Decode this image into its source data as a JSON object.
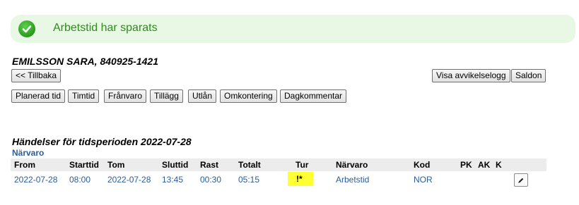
{
  "banner": {
    "message": "Arbetstid har sparats",
    "icon": "check-icon",
    "color": "#2e8b1c"
  },
  "person": {
    "title": "EMILSSON SARA, 840925-1421"
  },
  "nav": {
    "back_label": "<< Tillbaka",
    "deviation_log_label": "Visa avvikelselogg",
    "balances_label": "Saldon"
  },
  "tabs": [
    {
      "label": "Planerad tid"
    },
    {
      "label": "Timtid"
    },
    {
      "label": "Frånvaro"
    },
    {
      "label": "Tillägg"
    },
    {
      "label": "Utlån"
    },
    {
      "label": "Omkontering"
    },
    {
      "label": "Dagkommentar"
    }
  ],
  "events": {
    "title": "Händelser för tidsperioden 2022-07-28",
    "subtitle": "Närvaro",
    "columns": [
      "From",
      "Starttid",
      "Tom",
      "Sluttid",
      "Rast",
      "Totalt",
      "Tur",
      "Närvaro",
      "Kod",
      "PK",
      "AK",
      "K"
    ],
    "rows": [
      {
        "from": "2022-07-28",
        "starttid": "08:00",
        "tom": "2022-07-28",
        "sluttid": "13:45",
        "rast": "00:30",
        "totalt": "05:15",
        "tur": "!*",
        "narvaro": "Arbetstid",
        "kod": "NOR",
        "pk": "",
        "ak": "",
        "k": ""
      }
    ]
  }
}
